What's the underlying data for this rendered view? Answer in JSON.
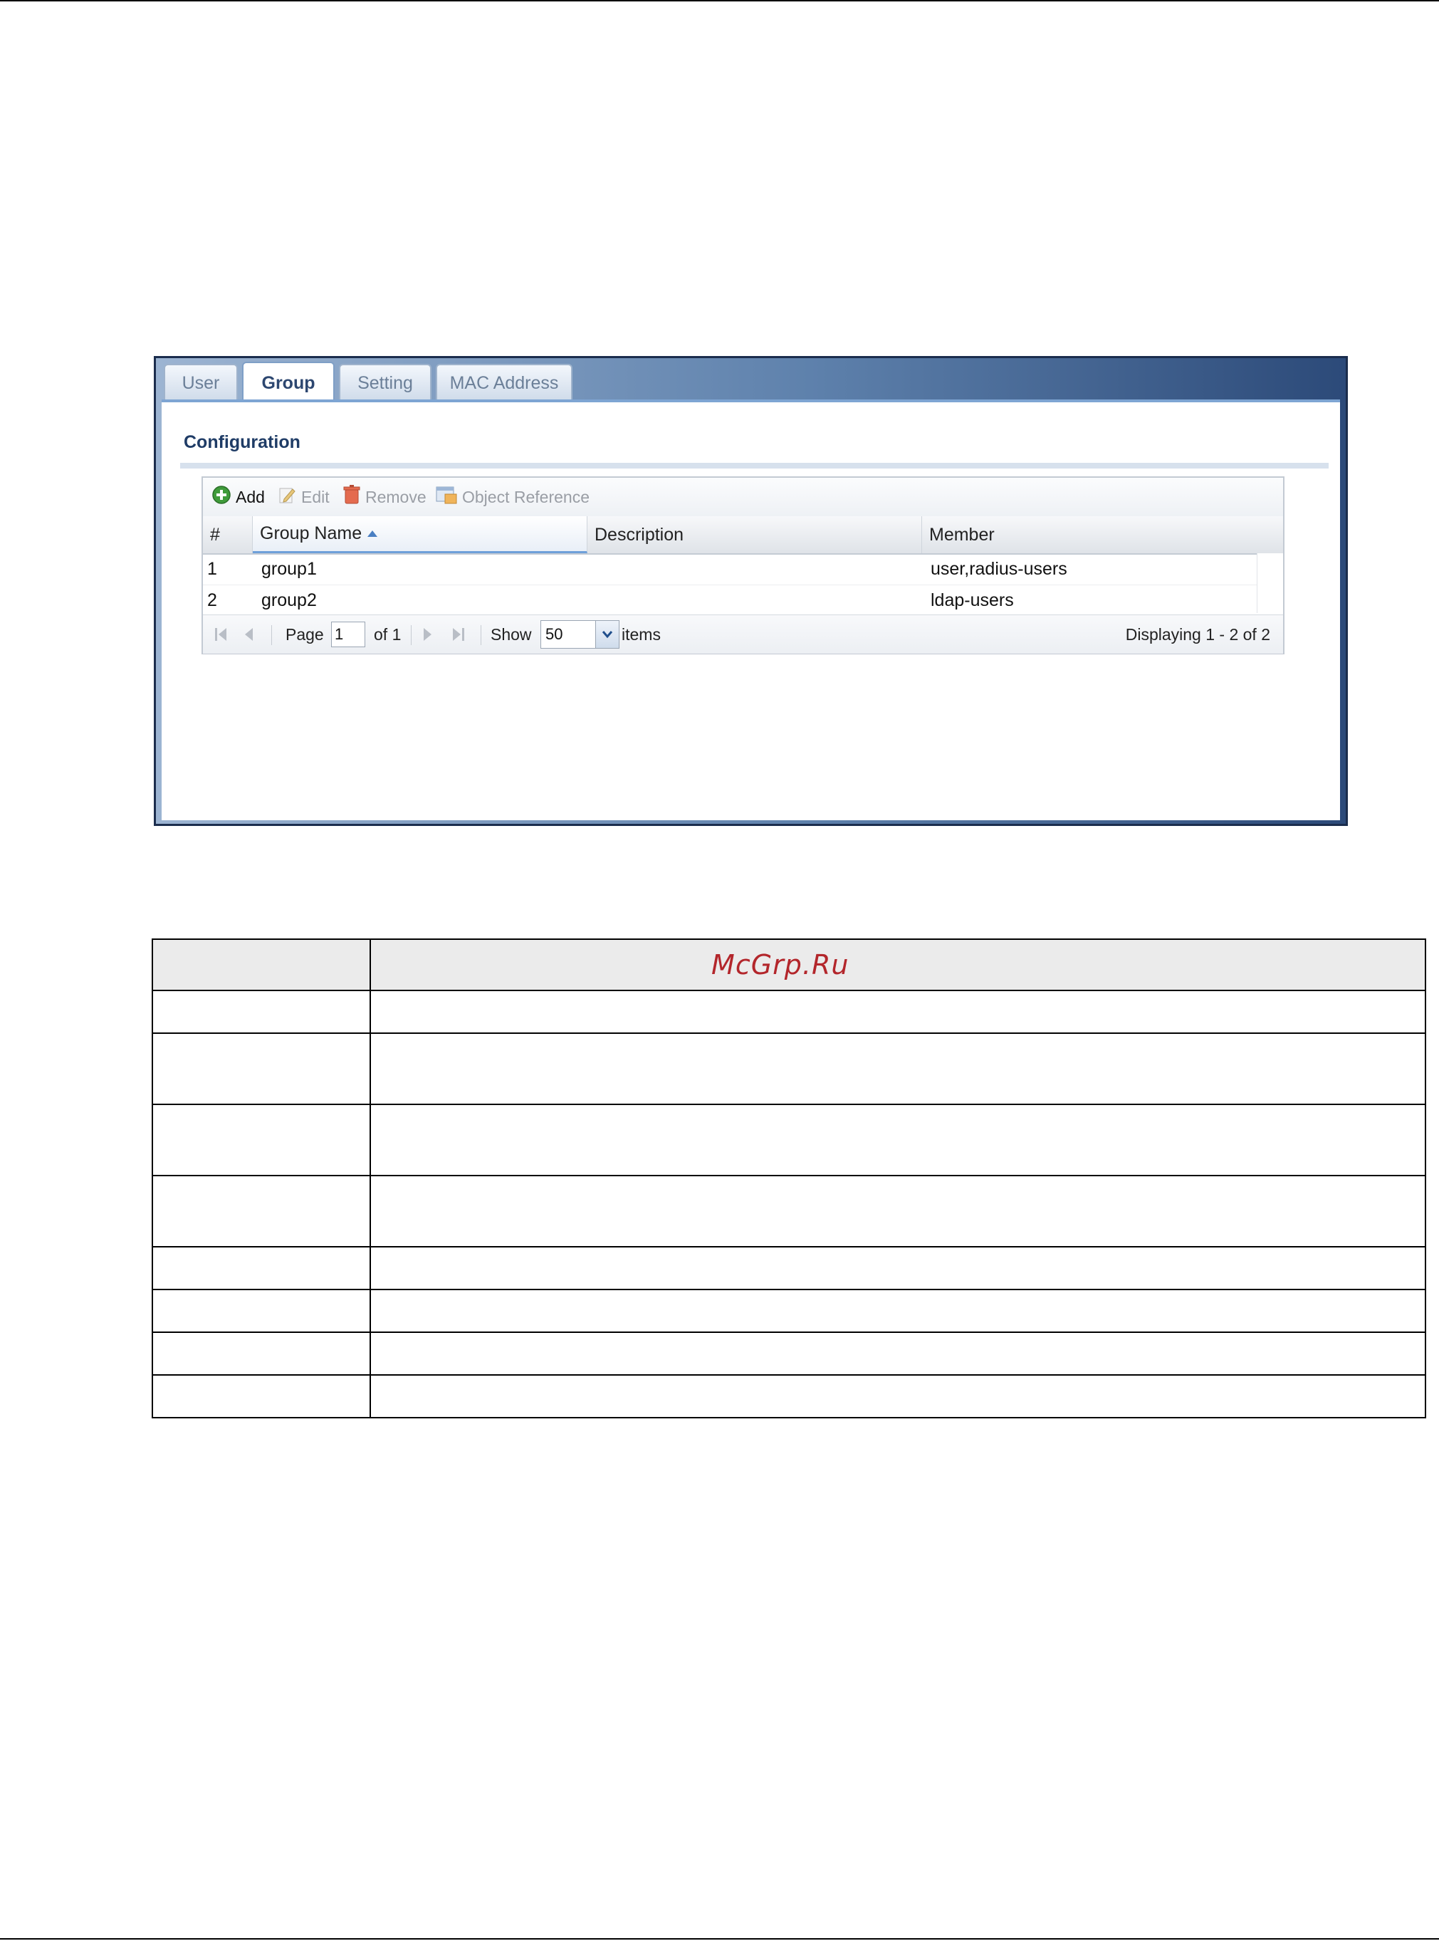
{
  "tabs": [
    {
      "label": "User",
      "active": false
    },
    {
      "label": "Group",
      "active": true
    },
    {
      "label": "Setting",
      "active": false
    },
    {
      "label": "MAC Address",
      "active": false
    }
  ],
  "section_title": "Configuration",
  "toolbar": {
    "add": "Add",
    "edit": "Edit",
    "remove": "Remove",
    "object_reference": "Object Reference"
  },
  "table": {
    "columns": [
      "#",
      "Group Name",
      "Description",
      "Member"
    ],
    "rows": [
      {
        "num": "1",
        "group_name": "group1",
        "description": "",
        "member": "user,radius-users"
      },
      {
        "num": "2",
        "group_name": "group2",
        "description": "",
        "member": "ldap-users"
      }
    ]
  },
  "pager": {
    "page_label": "Page",
    "page_value": "1",
    "of_label": "of 1",
    "show_label": "Show",
    "show_value": "50",
    "items_label": "items",
    "displaying": "Displaying 1 - 2 of 2"
  },
  "doc_table": {
    "watermark": "McGrp.Ru"
  },
  "colors": {
    "accent": "#2d4770",
    "watermark": "#b3262b",
    "window_border": "#1b2d4d"
  }
}
